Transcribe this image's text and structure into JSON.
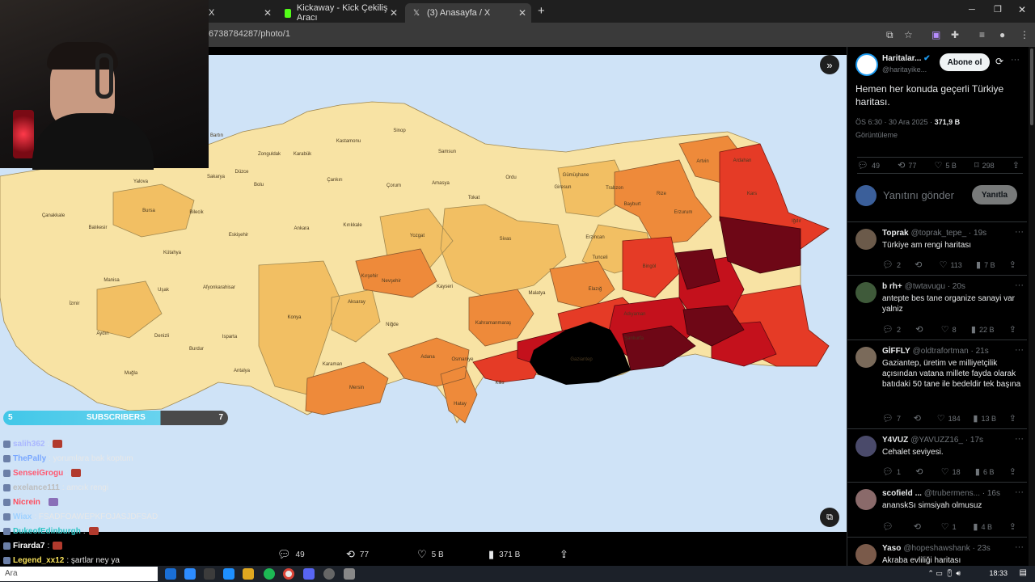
{
  "browser": {
    "tabs": [
      {
        "title": "X",
        "icon": "x-logo-icon",
        "active": false
      },
      {
        "title": "Kickaway - Kick Çekiliş Aracı",
        "icon": "kick-logo-icon",
        "active": false
      },
      {
        "title": "(3) Anasayfa / X",
        "icon": "x-logo-icon",
        "active": true
      }
    ],
    "url": "6738784287/photo/1",
    "window_controls": [
      "minimize",
      "restore",
      "close"
    ]
  },
  "viewer": {
    "stats": {
      "replies": "49",
      "reposts": "77",
      "likes": "5 B",
      "views": "371 B"
    }
  },
  "map": {
    "labels": [
      "Bartın",
      "Kastamonu",
      "Sinop",
      "Zonguldak",
      "Karabük",
      "Samsun",
      "Artvin",
      "Ardahan",
      "Sakarya",
      "Düzce",
      "Yalova",
      "Bolu",
      "Çankırı",
      "Çorum",
      "Amasya",
      "Ordu",
      "Giresun",
      "Trabzon",
      "Rize",
      "Kars",
      "Çanakkale",
      "Balıkesir",
      "Bursa",
      "Bilecik",
      "Eskişehir",
      "Ankara",
      "Kırıkkale",
      "Yozgat",
      "Tokat",
      "Gümüşhane",
      "Bayburt",
      "Erzurum",
      "Iğdır",
      "Kütahya",
      "Kırşehir",
      "Sivas",
      "Erzincan",
      "Manisa",
      "Uşak",
      "Afyonkarahisar",
      "Nevşehir",
      "Kayseri",
      "Tunceli",
      "Bingöl",
      "İzmir",
      "Aksaray",
      "Malatya",
      "Elazığ",
      "Konya",
      "Isparta",
      "Aydın",
      "Denizli",
      "Niğde",
      "Kahramanmaraş",
      "Adıyaman",
      "Burdur",
      "Adana",
      "Osmaniye",
      "Muğla",
      "Karaman",
      "Antalya",
      "Mersin",
      "Hatay",
      "Gaziantep",
      "Kilis",
      "Şanlıurfa"
    ],
    "accent_colors": [
      "#f8e3a4",
      "#f2bf63",
      "#ee8a3a",
      "#e53b26",
      "#c4111c",
      "#6e0716",
      "#000000"
    ]
  },
  "overlay": {
    "subscribers": {
      "label": "SUBSCRIBERS",
      "left": "5",
      "right": "7",
      "progress": 0.7
    },
    "chat": [
      {
        "user": "salih362",
        "color": "#aab7ff",
        "msg": ":",
        "emote": "#b13a2d"
      },
      {
        "user": "ThePally",
        "color": "#7aa8ff",
        "msg": ": yorumlara bak koptum",
        "emote": ""
      },
      {
        "user": "SenseiGrogu",
        "color": "#ff5a72",
        "msg": ":",
        "emote": "#b13a2d"
      },
      {
        "user": "exelance111",
        "color": "#bdbdbd",
        "msg": ": amcık rengi",
        "emote": ""
      },
      {
        "user": "Nicrein",
        "color": "#ff4b5c",
        "msg": ":",
        "emote": "#8a6fb8"
      },
      {
        "user": "Wiax",
        "color": "#9fd1ff",
        "msg": ": FSADFOAWEPKFOJASJDFSAD",
        "emote": ""
      },
      {
        "user": "DukeofEdinburgh",
        "color": "#2ec4c4",
        "msg": ":",
        "emote": "#b13a2d"
      },
      {
        "user": "Firarda7",
        "color": "#ffffff",
        "msg": ":",
        "emote": "#b13a2d"
      },
      {
        "user": "Legend_xx12",
        "color": "#f7e15a",
        "msg": ": şartlar ney ya",
        "emote": ""
      }
    ]
  },
  "tweet": {
    "author": "Haritalar...",
    "handle": "@haritayike...",
    "follow_label": "Abone ol",
    "text": "Hemen her konuda geçerli Türkiye haritası.",
    "time": "ÖS 6:30 · 30 Ara 2025 ·",
    "views": "371,9 B",
    "views_label": "Görüntüleme",
    "stats": {
      "replies": "49",
      "reposts": "77",
      "likes": "5 B",
      "bookmarks": "298"
    },
    "reply_placeholder": "Yanıtını gönder",
    "reply_button": "Yanıtla"
  },
  "replies": [
    {
      "name": "Toprak",
      "handle": "@toprak_tepe_ · 19s",
      "text": "Türkiye am rengi haritası",
      "replies": "2",
      "likes": "113",
      "views": "7 B",
      "avatar": "#6b5a4a"
    },
    {
      "name": "b rh+",
      "handle": "@twtavugu · 20s",
      "text": "antepte bes tane organize sanayi var yalniz",
      "replies": "2",
      "likes": "8",
      "views": "22 B",
      "avatar": "#3f5a3a"
    },
    {
      "name": "GİFFLY",
      "handle": "@oldtrafortman · 21s",
      "text": "Gaziantep, üretim ve milliyetçilik açısından vatana millete fayda olarak batıdaki 50 tane ile bedeldir tek başına",
      "replies": "7",
      "likes": "184",
      "views": "13 B",
      "avatar": "#7a6a5a"
    },
    {
      "name": "Y4VUZ",
      "handle": "@YAVUZZ16_ · 17s",
      "text": "Cehalet seviyesi.",
      "replies": "1",
      "likes": "18",
      "views": "6 B",
      "avatar": "#4a4a6a"
    },
    {
      "name": "scofield ...",
      "handle": "@trubermens... · 16s",
      "text": "ananskSı simsiyah olmusuz",
      "replies": "",
      "likes": "1",
      "views": "4 B",
      "avatar": "#8a6a6a"
    },
    {
      "name": "Yaso",
      "handle": "@hopeshawshank · 23s",
      "text": "Akraba evliliği haritası",
      "replies": "",
      "likes": "",
      "views": "",
      "avatar": "#7a5a4a"
    }
  ],
  "taskbar": {
    "search_text": "Ara",
    "time": "18:33"
  }
}
